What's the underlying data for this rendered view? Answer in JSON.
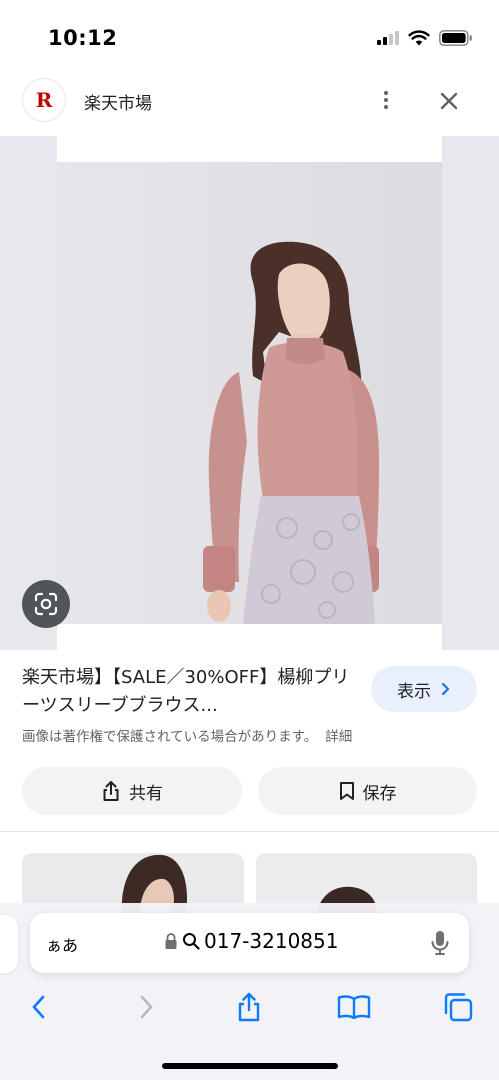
{
  "status_bar": {
    "time": "10:12"
  },
  "header": {
    "site_logo_letter": "R",
    "site_name": "楽天市場"
  },
  "result": {
    "title": "楽天市場】【SALE／30%OFF】楊柳プリーツスリーブブラウス...",
    "view_button_label": "表示",
    "copyright_notice": "画像は著作権で保護されている場合があります。",
    "details_link": "詳細",
    "share_label": "共有",
    "save_label": "保存"
  },
  "browser": {
    "text_size_label": "ぁあ",
    "url_text": "017-3210851"
  },
  "colors": {
    "brand_red": "#bf0000",
    "link_blue": "#1a73e8",
    "view_button_bg": "#e8f0fe"
  },
  "icons": {
    "signal": "signal-icon",
    "wifi": "wifi-icon",
    "battery": "battery-icon",
    "more": "more-vert-icon",
    "close": "close-icon",
    "lens": "lens-icon",
    "share": "share-icon",
    "save": "bookmark-icon",
    "back": "back-icon",
    "forward": "forward-icon",
    "book": "bookmarks-icon",
    "tabs": "tabs-icon"
  }
}
